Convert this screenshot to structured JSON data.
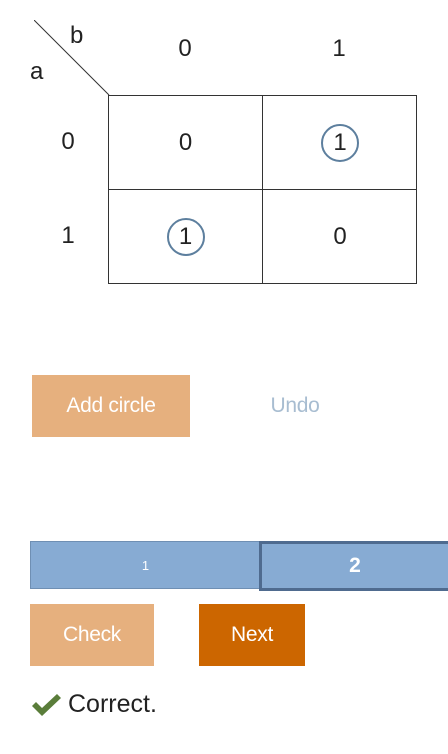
{
  "kmap": {
    "var_row": "a",
    "var_col": "b",
    "col_headers": [
      "0",
      "1"
    ],
    "row_headers": [
      "0",
      "1"
    ],
    "cells": [
      [
        {
          "value": "0",
          "circled": false
        },
        {
          "value": "1",
          "circled": true
        }
      ],
      [
        {
          "value": "1",
          "circled": true
        },
        {
          "value": "0",
          "circled": false
        }
      ]
    ]
  },
  "actions": {
    "add_circle_label": "Add circle",
    "undo_label": "Undo"
  },
  "pager": {
    "pages": [
      "1",
      "2"
    ],
    "current": "2"
  },
  "controls": {
    "check_label": "Check",
    "next_label": "Next"
  },
  "feedback": {
    "icon": "checkmark-icon",
    "text": "Correct."
  },
  "colors": {
    "circle": "#5d7f9e",
    "button_orange_light": "#e6b07e",
    "button_orange_dark": "#cc6600",
    "pager_blue": "#87abd3",
    "pager_border": "#4f6b8f",
    "undo_text": "#a8bdd1",
    "check_green": "#5a7d3a"
  }
}
